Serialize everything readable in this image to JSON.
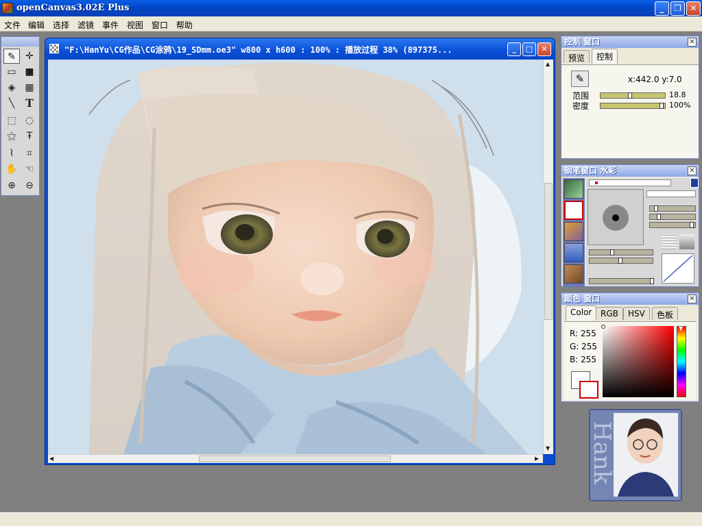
{
  "app": {
    "title": "openCanvas3.02E Plus",
    "min": "_",
    "max": "❐",
    "close": "✕"
  },
  "menu": [
    "文件",
    "编辑",
    "选择",
    "滤镜",
    "事件",
    "视图",
    "窗口",
    "帮助"
  ],
  "tools": [
    {
      "name": "pen-tool-icon",
      "glyph": "✎"
    },
    {
      "name": "move-tool-icon",
      "glyph": "✛"
    },
    {
      "name": "rect-outline-tool-icon",
      "glyph": "▭"
    },
    {
      "name": "rect-fill-tool-icon",
      "glyph": "■"
    },
    {
      "name": "bucket-tool-icon",
      "glyph": "◈"
    },
    {
      "name": "gradient-tool-icon",
      "glyph": "▦"
    },
    {
      "name": "line-tool-icon",
      "glyph": "╲"
    },
    {
      "name": "text-tool-icon",
      "glyph": "T"
    },
    {
      "name": "rect-select-tool-icon",
      "glyph": "⬚"
    },
    {
      "name": "lasso-tool-icon",
      "glyph": "◌"
    },
    {
      "name": "wand-tool-icon",
      "glyph": "⚝"
    },
    {
      "name": "text-select-tool-icon",
      "glyph": "Ŧ"
    },
    {
      "name": "eyedropper-tool-icon",
      "glyph": "⌇"
    },
    {
      "name": "crop-tool-icon",
      "glyph": "⌗"
    },
    {
      "name": "hand-tool-icon",
      "glyph": "✋"
    },
    {
      "name": "rotate-hand-tool-icon",
      "glyph": "☜"
    },
    {
      "name": "zoom-in-tool-icon",
      "glyph": "⊕"
    },
    {
      "name": "zoom-out-tool-icon",
      "glyph": "⊖"
    }
  ],
  "document": {
    "title": "\"F:\\HanYu\\CG作品\\CG涂鸦\\19_SDmm.oe3\" w800 x h600 : 100% : 播放过程 38% (897375..."
  },
  "control_panel": {
    "title": "控制 窗口",
    "tabs": [
      "预览",
      "控制"
    ],
    "active_tab": "控制",
    "coords": "x:442.0  y:7.0",
    "range_label": "范围",
    "range_value": "18.8",
    "range_fraction": 0.35,
    "density_label": "密度",
    "density_value": "100%",
    "density_fraction": 1.0
  },
  "brush_panel": {
    "title": "钢笔窗口  水彩"
  },
  "color_panel": {
    "title": "颜色 窗口",
    "tabs": [
      "Color",
      "RGB",
      "HSV",
      "色板"
    ],
    "active_tab": "Color",
    "r": "R: 255",
    "g": "G: 255",
    "b": "B: 255",
    "primary": "#ffffff",
    "secondary": "#ffffff"
  },
  "avatar": {
    "signature": "Hank"
  }
}
